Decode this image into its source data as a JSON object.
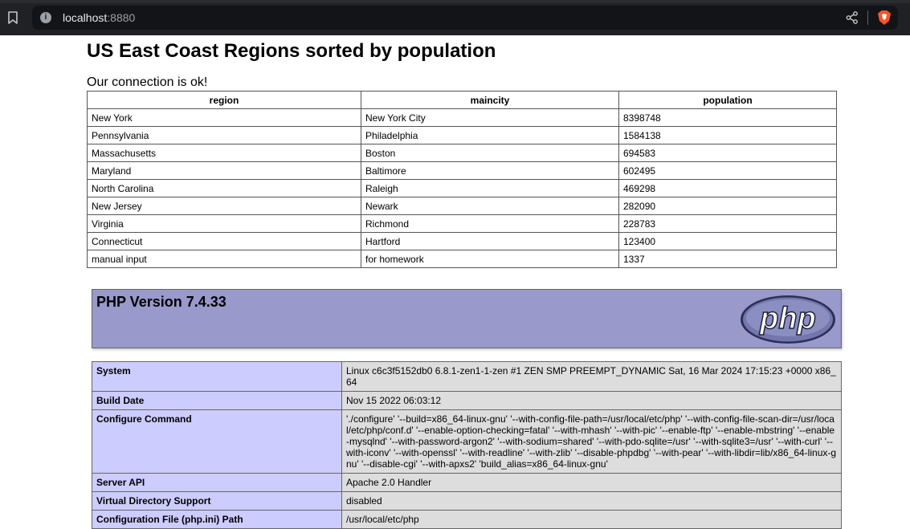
{
  "browser": {
    "url_host": "localhost",
    "url_port": ":8880"
  },
  "page": {
    "title": "US East Coast Regions sorted by population",
    "status": "Our connection is ok!"
  },
  "regions_table": {
    "headers": [
      "region",
      "maincity",
      "population"
    ],
    "rows": [
      [
        "New York",
        "New York City",
        "8398748"
      ],
      [
        "Pennsylvania",
        "Philadelphia",
        "1584138"
      ],
      [
        "Massachusetts",
        "Boston",
        "694583"
      ],
      [
        "Maryland",
        "Baltimore",
        "602495"
      ],
      [
        "North Carolina",
        "Raleigh",
        "469298"
      ],
      [
        "New Jersey",
        "Newark",
        "282090"
      ],
      [
        "Virginia",
        "Richmond",
        "228783"
      ],
      [
        "Connecticut",
        "Hartford",
        "123400"
      ],
      [
        "manual input",
        "for homework",
        "1337"
      ]
    ]
  },
  "phpinfo": {
    "version": "PHP Version 7.4.33",
    "logo_text": "php",
    "rows": [
      {
        "key": "System",
        "value": "Linux c6c3f5152db0 6.8.1-zen1-1-zen #1 ZEN SMP PREEMPT_DYNAMIC Sat, 16 Mar 2024 17:15:23 +0000 x86_64"
      },
      {
        "key": "Build Date",
        "value": "Nov 15 2022 06:03:12"
      },
      {
        "key": "Configure Command",
        "value": "'./configure' '--build=x86_64-linux-gnu' '--with-config-file-path=/usr/local/etc/php' '--with-config-file-scan-dir=/usr/local/etc/php/conf.d' '--enable-option-checking=fatal' '--with-mhash' '--with-pic' '--enable-ftp' '--enable-mbstring' '--enable-mysqlnd' '--with-password-argon2' '--with-sodium=shared' '--with-pdo-sqlite=/usr' '--with-sqlite3=/usr' '--with-curl' '--with-iconv' '--with-openssl' '--with-readline' '--with-zlib' '--disable-phpdbg' '--with-pear' '--with-libdir=lib/x86_64-linux-gnu' '--disable-cgi' '--with-apxs2' 'build_alias=x86_64-linux-gnu'"
      },
      {
        "key": "Server API",
        "value": "Apache 2.0 Handler"
      },
      {
        "key": "Virtual Directory Support",
        "value": "disabled"
      },
      {
        "key": "Configuration File (php.ini) Path",
        "value": "/usr/local/etc/php"
      }
    ]
  },
  "colors": {
    "chrome_bg": "#202124",
    "urlbar_bg": "#131417",
    "php_header_bg": "#9999cc",
    "php_key_bg": "#ccccff",
    "php_value_bg": "#dddddd",
    "brave_orange": "#fb542b"
  }
}
